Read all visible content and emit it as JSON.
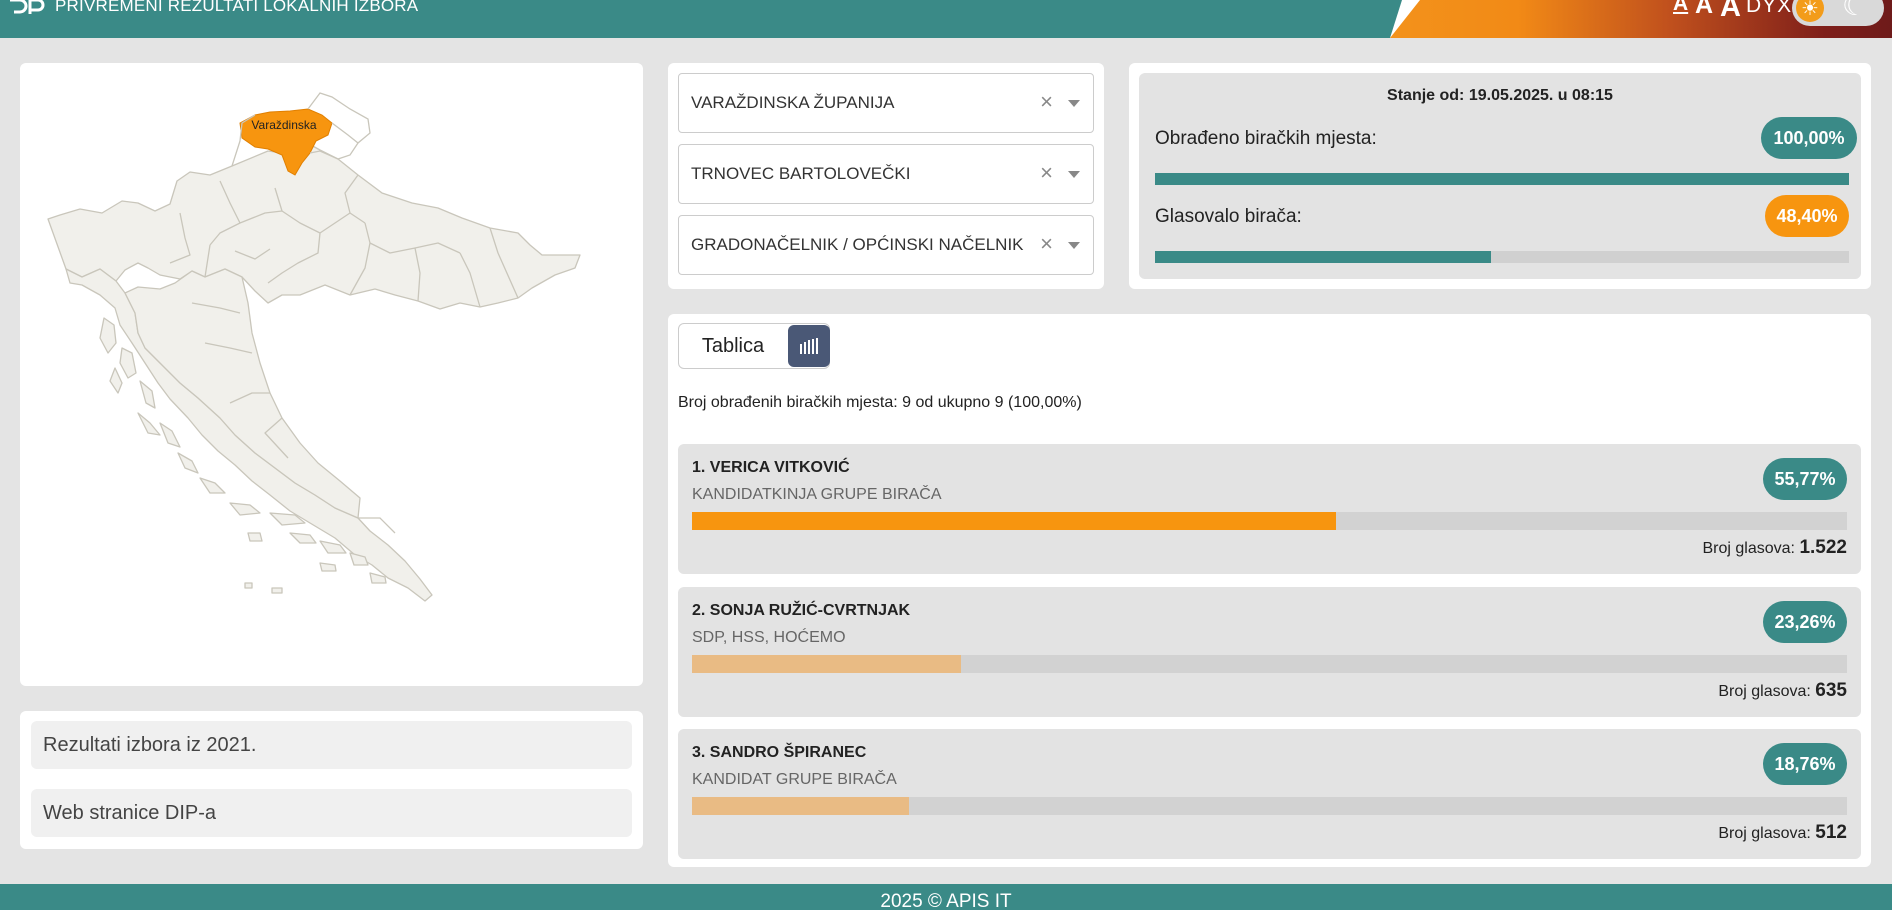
{
  "header": {
    "title": "PRIVREMENI REZULTATI LOKALNIH IZBORA",
    "font_small": "A",
    "font_medium": "A",
    "font_large": "A",
    "dyslexic": "DYX",
    "theme_light_icon": "sun-icon",
    "theme_dark_icon": "moon-icon"
  },
  "map": {
    "highlighted_region": "Varaždinska",
    "highlight_color": "#f7950f"
  },
  "links": [
    {
      "label": "Rezultati izbora iz 2021."
    },
    {
      "label": "Web stranice DIP-a"
    }
  ],
  "filters": {
    "county": "VARAŽDINSKA ŽUPANIJA",
    "municipality": "TRNOVEC BARTOLOVEČKI",
    "election_type": "GRADONAČELNIK / OPĆINSKI NAČELNIK",
    "clear_symbol": "×"
  },
  "status": {
    "date_text": "Stanje od: 19.05.2025. u 08:15",
    "processed_label": "Obrađeno biračkih mjesta:",
    "processed_value": "100,00%",
    "processed_fraction": 1.0,
    "turnout_label": "Glasovalo birača:",
    "turnout_value": "48,40%",
    "turnout_fraction": 0.484
  },
  "results": {
    "view_table_label": "Tablica",
    "view_chart_icon": "bar-chart-icon",
    "processed_text": "Broj obrađenih biračkih mjesta: 9 od ukupno 9 (100,00%)",
    "votes_label": "Broj glasova:",
    "candidates": [
      {
        "name": "1. VERICA VITKOVIĆ",
        "party": "KANDIDATKINJA GRUPE BIRAČA",
        "percent": "55,77%",
        "fraction": 0.5577,
        "votes": "1.522"
      },
      {
        "name": "2. SONJA RUŽIĆ-CVRTNJAK",
        "party": "SDP, HSS, HOĆEMO",
        "percent": "23,26%",
        "fraction": 0.2326,
        "votes": "635"
      },
      {
        "name": "3. SANDRO ŠPIRANEC",
        "party": "KANDIDAT GRUPE BIRAČA",
        "percent": "18,76%",
        "fraction": 0.1876,
        "votes": "512"
      }
    ]
  },
  "footer": {
    "text": "2025 © APIS IT"
  }
}
